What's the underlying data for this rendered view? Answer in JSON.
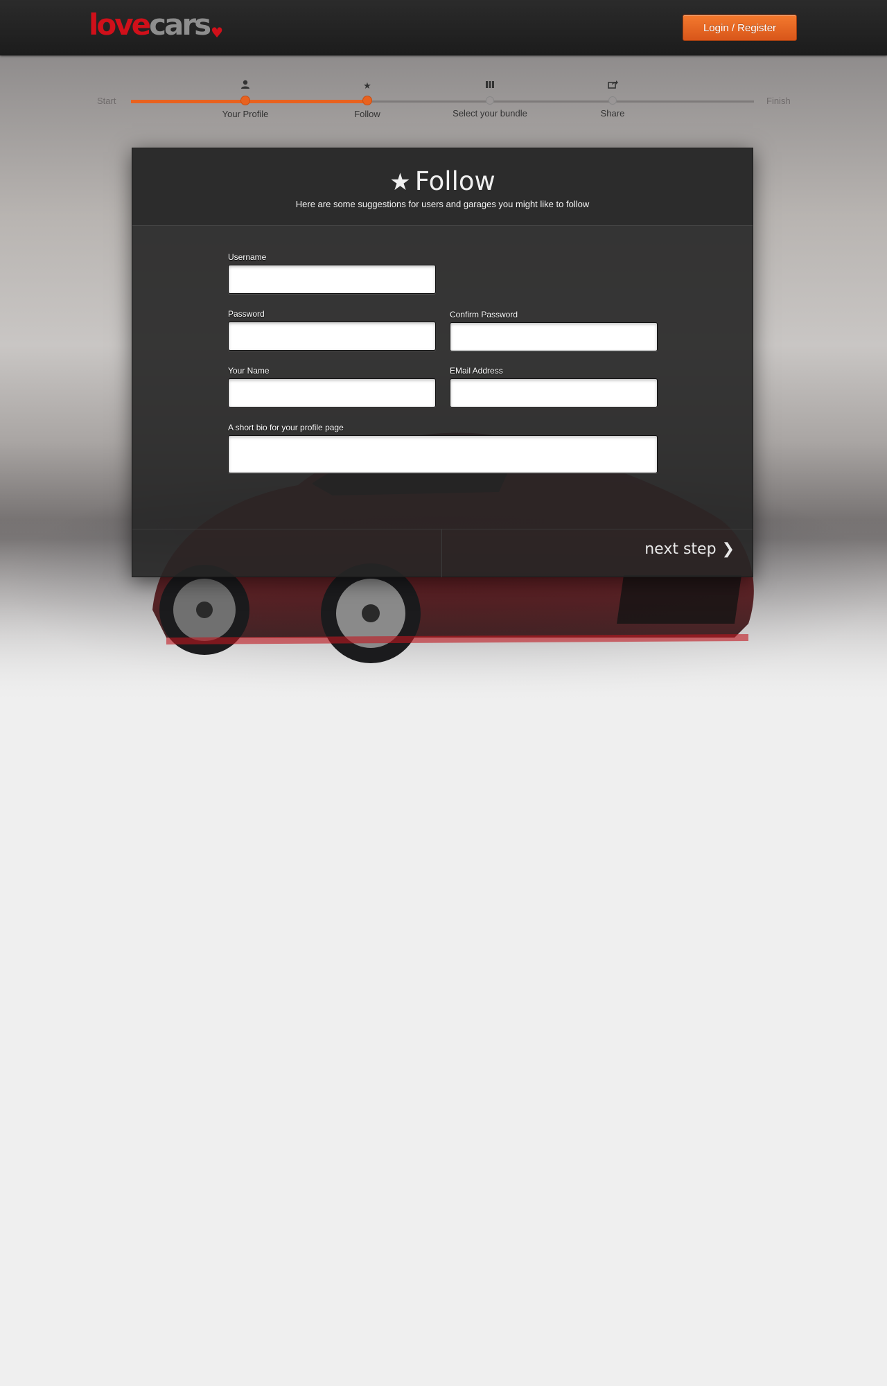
{
  "header": {
    "logo_love": "love",
    "logo_cars": "cars",
    "login_label": "Login / Register"
  },
  "progress": {
    "start_label": "Start",
    "finish_label": "Finish",
    "completed_fraction": 0.38,
    "steps": [
      {
        "label": "Your Profile",
        "icon": "user-icon",
        "done": true
      },
      {
        "label": "Follow",
        "icon": "star-icon",
        "done": true
      },
      {
        "label": "Select your bundle",
        "icon": "bars-icon",
        "done": false
      },
      {
        "label": "Share",
        "icon": "share-icon",
        "done": false
      }
    ]
  },
  "panel": {
    "title": "Follow",
    "title_icon": "star-icon",
    "subtitle": "Here are some suggestions for users and garages you might like to follow",
    "fields": {
      "username": {
        "label": "Username",
        "value": ""
      },
      "password": {
        "label": "Password",
        "value": ""
      },
      "confirm_password": {
        "label": "Confirm Password",
        "value": ""
      },
      "your_name": {
        "label": "Your Name",
        "value": ""
      },
      "email": {
        "label": "EMail Address",
        "value": ""
      },
      "bio": {
        "label": "A short bio for your profile page",
        "value": ""
      }
    },
    "next_label": "next step"
  },
  "colors": {
    "accent": "#e8621f",
    "logo_red": "#d0101a",
    "logo_gray": "#8e8e8e",
    "header_bg": "#222222",
    "page_bg": "#efefef"
  }
}
